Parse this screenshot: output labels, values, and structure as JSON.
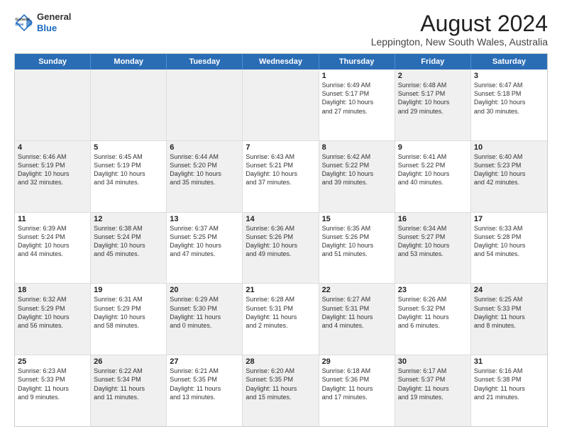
{
  "logo": {
    "line1": "General",
    "line2": "Blue"
  },
  "title": "August 2024",
  "location": "Leppington, New South Wales, Australia",
  "headers": [
    "Sunday",
    "Monday",
    "Tuesday",
    "Wednesday",
    "Thursday",
    "Friday",
    "Saturday"
  ],
  "rows": [
    [
      {
        "day": "",
        "info": "",
        "shaded": true
      },
      {
        "day": "",
        "info": "",
        "shaded": true
      },
      {
        "day": "",
        "info": "",
        "shaded": true
      },
      {
        "day": "",
        "info": "",
        "shaded": true
      },
      {
        "day": "1",
        "info": "Sunrise: 6:49 AM\nSunset: 5:17 PM\nDaylight: 10 hours\nand 27 minutes.",
        "shaded": false
      },
      {
        "day": "2",
        "info": "Sunrise: 6:48 AM\nSunset: 5:17 PM\nDaylight: 10 hours\nand 29 minutes.",
        "shaded": true
      },
      {
        "day": "3",
        "info": "Sunrise: 6:47 AM\nSunset: 5:18 PM\nDaylight: 10 hours\nand 30 minutes.",
        "shaded": false
      }
    ],
    [
      {
        "day": "4",
        "info": "Sunrise: 6:46 AM\nSunset: 5:19 PM\nDaylight: 10 hours\nand 32 minutes.",
        "shaded": true
      },
      {
        "day": "5",
        "info": "Sunrise: 6:45 AM\nSunset: 5:19 PM\nDaylight: 10 hours\nand 34 minutes.",
        "shaded": false
      },
      {
        "day": "6",
        "info": "Sunrise: 6:44 AM\nSunset: 5:20 PM\nDaylight: 10 hours\nand 35 minutes.",
        "shaded": true
      },
      {
        "day": "7",
        "info": "Sunrise: 6:43 AM\nSunset: 5:21 PM\nDaylight: 10 hours\nand 37 minutes.",
        "shaded": false
      },
      {
        "day": "8",
        "info": "Sunrise: 6:42 AM\nSunset: 5:22 PM\nDaylight: 10 hours\nand 39 minutes.",
        "shaded": true
      },
      {
        "day": "9",
        "info": "Sunrise: 6:41 AM\nSunset: 5:22 PM\nDaylight: 10 hours\nand 40 minutes.",
        "shaded": false
      },
      {
        "day": "10",
        "info": "Sunrise: 6:40 AM\nSunset: 5:23 PM\nDaylight: 10 hours\nand 42 minutes.",
        "shaded": true
      }
    ],
    [
      {
        "day": "11",
        "info": "Sunrise: 6:39 AM\nSunset: 5:24 PM\nDaylight: 10 hours\nand 44 minutes.",
        "shaded": false
      },
      {
        "day": "12",
        "info": "Sunrise: 6:38 AM\nSunset: 5:24 PM\nDaylight: 10 hours\nand 45 minutes.",
        "shaded": true
      },
      {
        "day": "13",
        "info": "Sunrise: 6:37 AM\nSunset: 5:25 PM\nDaylight: 10 hours\nand 47 minutes.",
        "shaded": false
      },
      {
        "day": "14",
        "info": "Sunrise: 6:36 AM\nSunset: 5:26 PM\nDaylight: 10 hours\nand 49 minutes.",
        "shaded": true
      },
      {
        "day": "15",
        "info": "Sunrise: 6:35 AM\nSunset: 5:26 PM\nDaylight: 10 hours\nand 51 minutes.",
        "shaded": false
      },
      {
        "day": "16",
        "info": "Sunrise: 6:34 AM\nSunset: 5:27 PM\nDaylight: 10 hours\nand 53 minutes.",
        "shaded": true
      },
      {
        "day": "17",
        "info": "Sunrise: 6:33 AM\nSunset: 5:28 PM\nDaylight: 10 hours\nand 54 minutes.",
        "shaded": false
      }
    ],
    [
      {
        "day": "18",
        "info": "Sunrise: 6:32 AM\nSunset: 5:29 PM\nDaylight: 10 hours\nand 56 minutes.",
        "shaded": true
      },
      {
        "day": "19",
        "info": "Sunrise: 6:31 AM\nSunset: 5:29 PM\nDaylight: 10 hours\nand 58 minutes.",
        "shaded": false
      },
      {
        "day": "20",
        "info": "Sunrise: 6:29 AM\nSunset: 5:30 PM\nDaylight: 11 hours\nand 0 minutes.",
        "shaded": true
      },
      {
        "day": "21",
        "info": "Sunrise: 6:28 AM\nSunset: 5:31 PM\nDaylight: 11 hours\nand 2 minutes.",
        "shaded": false
      },
      {
        "day": "22",
        "info": "Sunrise: 6:27 AM\nSunset: 5:31 PM\nDaylight: 11 hours\nand 4 minutes.",
        "shaded": true
      },
      {
        "day": "23",
        "info": "Sunrise: 6:26 AM\nSunset: 5:32 PM\nDaylight: 11 hours\nand 6 minutes.",
        "shaded": false
      },
      {
        "day": "24",
        "info": "Sunrise: 6:25 AM\nSunset: 5:33 PM\nDaylight: 11 hours\nand 8 minutes.",
        "shaded": true
      }
    ],
    [
      {
        "day": "25",
        "info": "Sunrise: 6:23 AM\nSunset: 5:33 PM\nDaylight: 11 hours\nand 9 minutes.",
        "shaded": false
      },
      {
        "day": "26",
        "info": "Sunrise: 6:22 AM\nSunset: 5:34 PM\nDaylight: 11 hours\nand 11 minutes.",
        "shaded": true
      },
      {
        "day": "27",
        "info": "Sunrise: 6:21 AM\nSunset: 5:35 PM\nDaylight: 11 hours\nand 13 minutes.",
        "shaded": false
      },
      {
        "day": "28",
        "info": "Sunrise: 6:20 AM\nSunset: 5:35 PM\nDaylight: 11 hours\nand 15 minutes.",
        "shaded": true
      },
      {
        "day": "29",
        "info": "Sunrise: 6:18 AM\nSunset: 5:36 PM\nDaylight: 11 hours\nand 17 minutes.",
        "shaded": false
      },
      {
        "day": "30",
        "info": "Sunrise: 6:17 AM\nSunset: 5:37 PM\nDaylight: 11 hours\nand 19 minutes.",
        "shaded": true
      },
      {
        "day": "31",
        "info": "Sunrise: 6:16 AM\nSunset: 5:38 PM\nDaylight: 11 hours\nand 21 minutes.",
        "shaded": false
      }
    ]
  ]
}
